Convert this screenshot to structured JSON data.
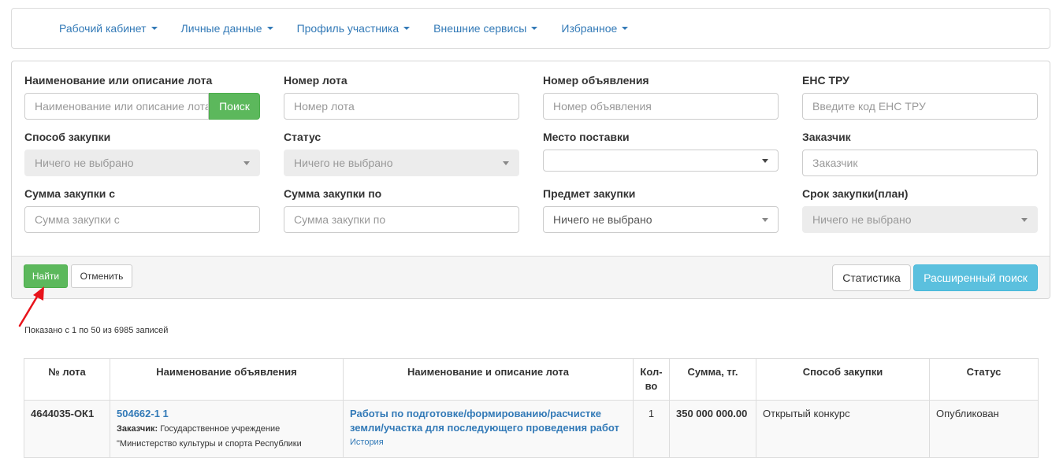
{
  "nav": {
    "items": [
      "Рабочий кабинет",
      "Личные данные",
      "Профиль участника",
      "Внешние сервисы",
      "Избранное"
    ]
  },
  "filters": {
    "lot_name": {
      "label": "Наименование или описание лота",
      "placeholder": "Наименование или описание лота",
      "button": "Поиск"
    },
    "lot_number": {
      "label": "Номер лота",
      "placeholder": "Номер лота"
    },
    "announcement_number": {
      "label": "Номер объявления",
      "placeholder": "Номер объявления"
    },
    "ens_tru": {
      "label": "ЕНС ТРУ",
      "placeholder": "Введите код ЕНС ТРУ"
    },
    "procurement_method": {
      "label": "Способ закупки",
      "value": "Ничего не выбрано"
    },
    "status": {
      "label": "Статус",
      "value": "Ничего не выбрано"
    },
    "delivery_place": {
      "label": "Место поставки",
      "value": ""
    },
    "customer": {
      "label": "Заказчик",
      "placeholder": "Заказчик"
    },
    "amount_from": {
      "label": "Сумма закупки с",
      "placeholder": "Сумма закупки с"
    },
    "amount_to": {
      "label": "Сумма закупки по",
      "placeholder": "Сумма закупки по"
    },
    "subject": {
      "label": "Предмет закупки",
      "value": "Ничего не выбрано"
    },
    "term": {
      "label": "Срок закупки(план)",
      "value": "Ничего не выбрано"
    }
  },
  "footer": {
    "find": "Найти",
    "cancel": "Отменить",
    "stats": "Статистика",
    "advanced": "Расширенный поиск"
  },
  "shown_text": "Показано с 1 по 50 из 6985 записей",
  "table": {
    "headers": [
      "№ лота",
      "Наименование объявления",
      "Наименование и описание лота",
      "Кол-во",
      "Сумма, тг.",
      "Способ закупки",
      "Статус"
    ],
    "rows": [
      {
        "lot": "4644035-ОК1",
        "announcement_link": "504662-1 1",
        "customer_label": "Заказчик:",
        "customer_text": "Государственное учреждение \"Министерство культуры и спорта Республики",
        "lot_desc": "Работы по подготовке/формированию/расчистке земли/участка для последующего проведения работ",
        "history": "История",
        "qty": "1",
        "sum": "350 000 000.00",
        "method": "Открытый конкурс",
        "status": "Опубликован"
      }
    ]
  },
  "colors": {
    "link": "#337ab7",
    "success": "#5cb85c",
    "info": "#5bc0de",
    "arrow": "#e8131b"
  }
}
